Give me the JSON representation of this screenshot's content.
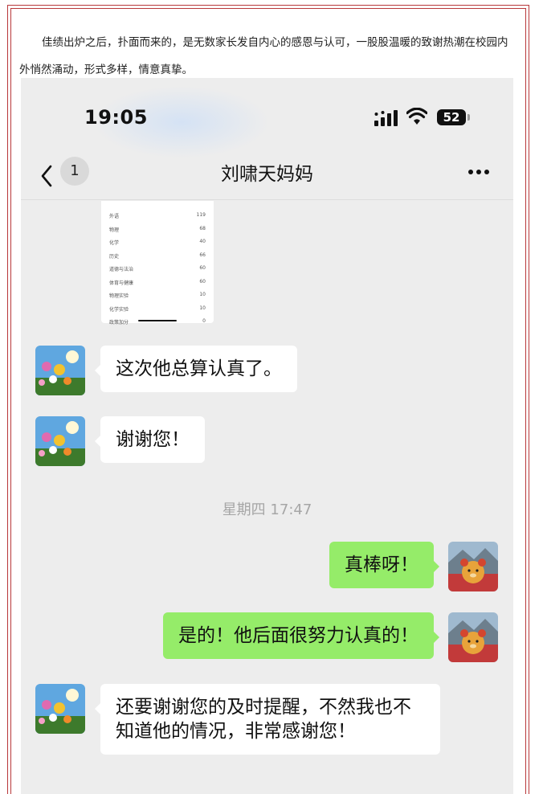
{
  "article": {
    "intro": "佳绩出炉之后，扑面而来的，是无数家长发自内心的感恩与认可，一股股温暖的致谢热潮在校园内外悄然涌动，形式多样，情意真挚。"
  },
  "statusbar": {
    "time": "19:05",
    "battery": "52",
    "icons": [
      "cellular-signal-icon",
      "wifi-icon",
      "battery-icon"
    ]
  },
  "navbar": {
    "unread_count": "1",
    "title": "刘啸天妈妈",
    "icons": [
      "back-chevron-icon",
      "more-options-icon"
    ]
  },
  "score_screenshot": {
    "rows": [
      {
        "subject": "外语",
        "score": "119"
      },
      {
        "subject": "物理",
        "score": "68"
      },
      {
        "subject": "化学",
        "score": "40"
      },
      {
        "subject": "历史",
        "score": "66"
      },
      {
        "subject": "道德与法治",
        "score": "60"
      },
      {
        "subject": "体育与健康",
        "score": "60"
      },
      {
        "subject": "物理实验",
        "score": "10"
      },
      {
        "subject": "化学实验",
        "score": "10"
      },
      {
        "subject": "政策加分",
        "score": "0"
      }
    ]
  },
  "messages": [
    {
      "side": "left",
      "text": "这次他总算认真了。"
    },
    {
      "side": "left",
      "text": "谢谢您！"
    },
    {
      "side": "right",
      "text": "真棒呀！"
    },
    {
      "side": "right",
      "text": "是的！他后面很努力认真的！"
    },
    {
      "side": "left",
      "text": "还要谢谢您的及时提醒，不然我也不知道他的情况，非常感谢您！"
    }
  ],
  "timestamp": "星期四 17:47",
  "colors": {
    "frame": "#b8383a",
    "chat_bg": "#ededed",
    "bubble_self": "#95ec69",
    "bubble_other": "#ffffff"
  }
}
